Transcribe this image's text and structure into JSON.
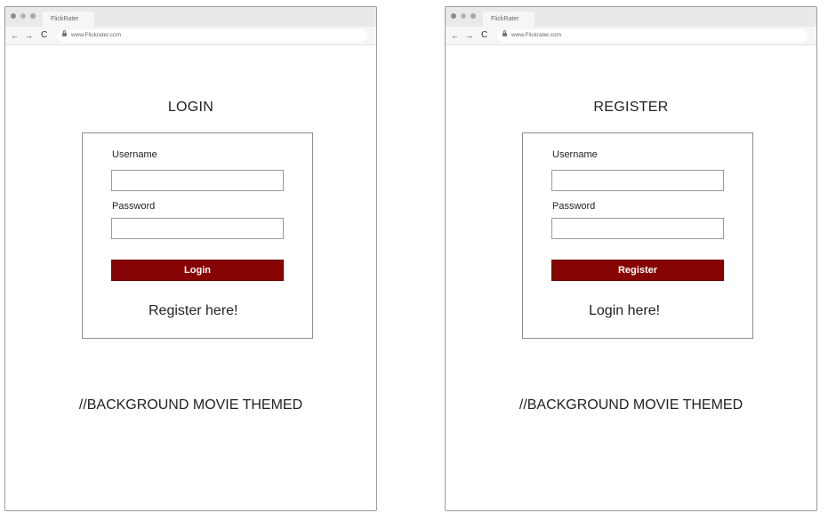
{
  "login_screen": {
    "browser": {
      "tab_title": "FlickRater",
      "url": "www.Flickrater.com",
      "back_icon": "←",
      "forward_icon": "→",
      "reload_icon": "C"
    },
    "heading": "LOGIN",
    "form": {
      "username_label": "Username",
      "username_value": "",
      "password_label": "Password",
      "password_value": "",
      "submit_label": "Login"
    },
    "switch_link": "Register here!",
    "background_note": "//BACKGROUND MOVIE THEMED"
  },
  "register_screen": {
    "browser": {
      "tab_title": "FlickRater",
      "url": "www.Flickrater.com",
      "back_icon": "←",
      "forward_icon": "→",
      "reload_icon": "C"
    },
    "heading": "REGISTER",
    "form": {
      "username_label": "Username",
      "username_value": "",
      "password_label": "Password",
      "password_value": "",
      "submit_label": "Register"
    },
    "switch_link": "Login here!",
    "background_note": "//BACKGROUND MOVIE THEMED"
  },
  "colors": {
    "button_background": "#870404",
    "button_text": "#ffffff",
    "border": "#8c8c8c",
    "browser_chrome": "#e9e9e9"
  }
}
